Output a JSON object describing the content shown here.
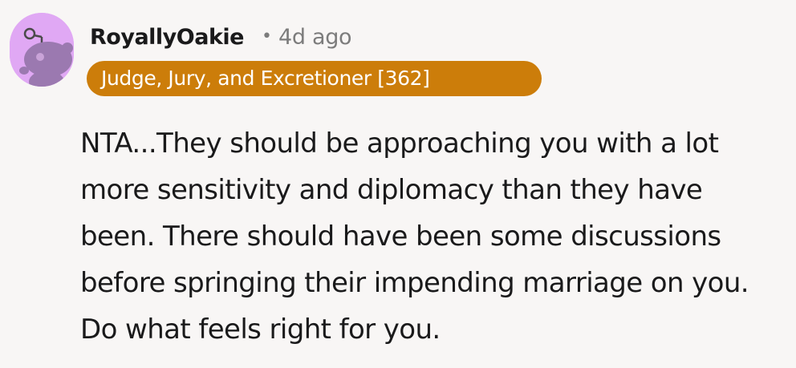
{
  "comment": {
    "author": "RoyallyOakie",
    "separator": "•",
    "age": "4d ago",
    "flair": "Judge, Jury, and Excretioner [362]",
    "flair_color": "#cc7d0a",
    "avatar_icon": "snoo-avatar-icon",
    "avatar_color": "#e0a8f4",
    "text": "NTA...They should be approaching you with a lot more sensitivity and diplomacy than they have been. There should have been some discussions before springing their impending marriage on you. Do what feels right for you."
  }
}
